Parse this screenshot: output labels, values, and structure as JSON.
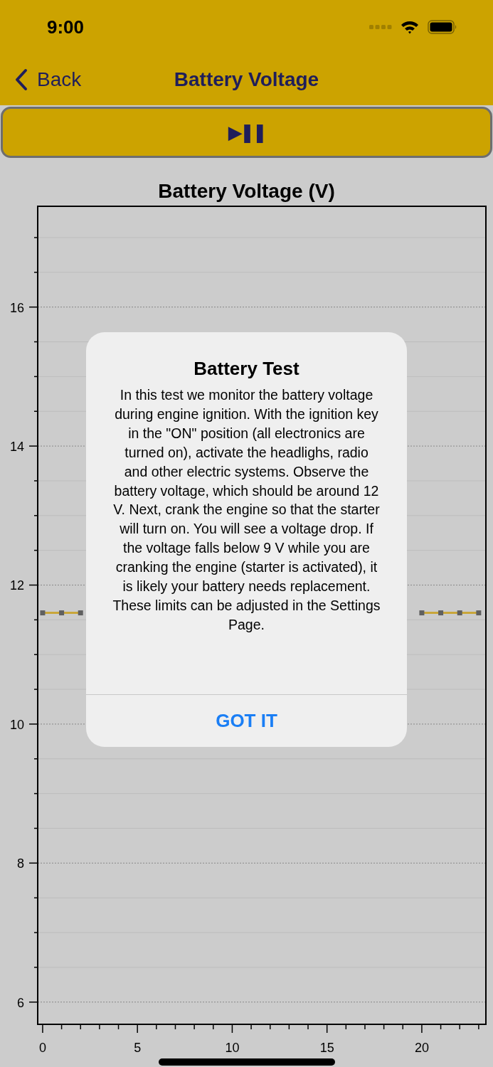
{
  "status_bar": {
    "time": "9:00"
  },
  "nav": {
    "back": "Back",
    "title": "Battery Voltage"
  },
  "play_pause": {
    "label": "▶︎❚❚"
  },
  "chart": {
    "chart_data": {
      "type": "line",
      "title": "Battery Voltage (V)",
      "x": [
        0,
        1,
        2,
        3,
        4,
        5,
        6,
        7,
        8,
        9,
        10,
        11,
        12,
        13,
        14,
        15,
        16,
        17,
        18,
        19,
        20,
        21,
        22,
        23
      ],
      "series": [
        {
          "color": "#c9a63a",
          "marker": "square",
          "values": [
            11.6,
            11.6,
            11.6,
            null,
            null,
            null,
            null,
            null,
            null,
            null,
            null,
            null,
            null,
            null,
            null,
            null,
            null,
            null,
            null,
            null,
            11.6,
            11.6,
            11.6,
            11.6
          ]
        }
      ],
      "grid": true,
      "xlim": [
        -0.26,
        23.38
      ],
      "ylim": [
        5.68,
        17.45
      ],
      "xticks": [
        0,
        5,
        10,
        15,
        20
      ],
      "yticks": [
        6,
        8,
        10,
        12,
        14,
        16
      ]
    }
  },
  "dialog": {
    "title": "Battery Test",
    "message": "In this test we monitor the battery voltage during engine ignition. With the ignition key in the \"ON\" position (all electronics are turned on), activate the headlighs, radio and other electric systems. Observe the battery voltage, which should be around 12 V. Next, crank the engine so that the starter will turn on. You will see a voltage drop. If the voltage falls below 9 V while you are cranking the engine (starter is activated), it is likely your battery needs replacement.\nThese limits can be adjusted in the Settings Page.",
    "button": "GOT IT"
  }
}
